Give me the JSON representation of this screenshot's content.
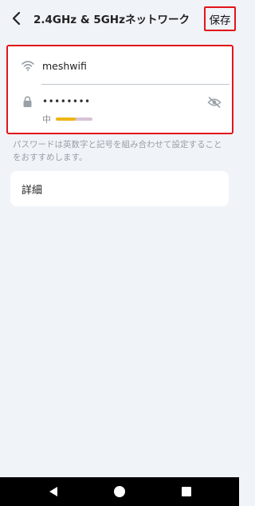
{
  "header": {
    "title": "2.4GHz & 5GHzネットワーク",
    "save_label": "保存"
  },
  "network": {
    "ssid": "meshwifi",
    "password_masked": "••••••••",
    "strength_label": "中",
    "strength_level": 0.55,
    "hint": "パスワードは英数字と記号を組み合わせて設定することをおすすめします。"
  },
  "details": {
    "label": "詳細"
  },
  "colors": {
    "highlight_border": "#e2141a",
    "strength_fill": "#f0b414",
    "strength_track": "#d6c3d6",
    "background": "#f0f3f8"
  },
  "icons": [
    "back-arrow-icon",
    "wifi-icon",
    "lock-icon",
    "eye-off-icon",
    "nav-back-icon",
    "nav-home-icon",
    "nav-recent-icon"
  ]
}
